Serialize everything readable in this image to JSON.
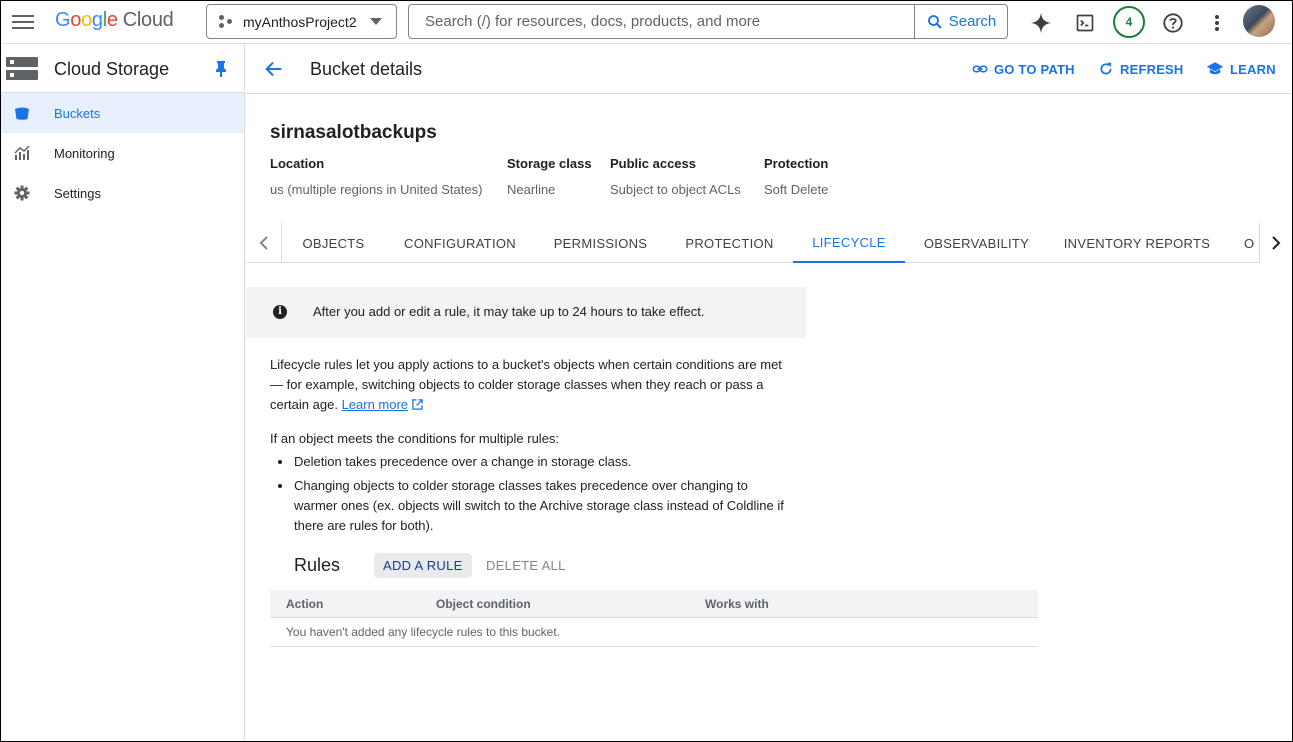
{
  "topbar": {
    "logo_letters": [
      "G",
      "o",
      "o",
      "g",
      "l",
      "e"
    ],
    "logo_product": "Cloud",
    "project_name": "myAnthosProject2",
    "search_placeholder": "Search (/) for resources, docs, products, and more",
    "search_button": "Search",
    "notification_count": "4",
    "icons": [
      "menu-icon",
      "gemini-icon",
      "cloud-shell-icon",
      "help-icon",
      "more-vert-icon"
    ]
  },
  "sidebar": {
    "title": "Cloud Storage",
    "items": [
      {
        "label": "Buckets",
        "icon": "bucket-icon",
        "active": true
      },
      {
        "label": "Monitoring",
        "icon": "monitoring-icon",
        "active": false
      },
      {
        "label": "Settings",
        "icon": "gear-icon",
        "active": false
      }
    ]
  },
  "header": {
    "title": "Bucket details",
    "actions": [
      "GO TO PATH",
      "REFRESH",
      "LEARN"
    ]
  },
  "bucket": {
    "name": "sirnasalotbackups",
    "meta": [
      {
        "key": "Location",
        "value": "us (multiple regions in United States)"
      },
      {
        "key": "Storage class",
        "value": "Nearline"
      },
      {
        "key": "Public access",
        "value": "Subject to object ACLs"
      },
      {
        "key": "Protection",
        "value": "Soft Delete"
      }
    ]
  },
  "tabs": [
    "OBJECTS",
    "CONFIGURATION",
    "PERMISSIONS",
    "PROTECTION",
    "LIFECYCLE",
    "OBSERVABILITY",
    "INVENTORY REPORTS",
    "O"
  ],
  "active_tab": "LIFECYCLE",
  "info_banner": "After you add or edit a rule, it may take up to 24 hours to take effect.",
  "description": {
    "text": "Lifecycle rules let you apply actions to a bucket's objects when certain conditions are met — for example, switching objects to colder storage classes when they reach or pass a certain age.",
    "link": "Learn more"
  },
  "conditions": {
    "intro": "If an object meets the conditions for multiple rules:",
    "bullets": [
      "Deletion takes precedence over a change in storage class.",
      "Changing objects to colder storage classes takes precedence over changing to warmer ones (ex. objects will switch to the Archive storage class instead of Coldline if there are rules for both)."
    ]
  },
  "rules": {
    "title": "Rules",
    "add_button": "ADD A RULE",
    "delete_button": "DELETE ALL",
    "columns": [
      "Action",
      "Object condition",
      "Works with"
    ],
    "empty_message": "You haven't added any lifecycle rules to this bucket."
  },
  "colors": {
    "accent": "#1a73e8",
    "badge": "#188038",
    "active_bg": "#e8f0fe"
  }
}
